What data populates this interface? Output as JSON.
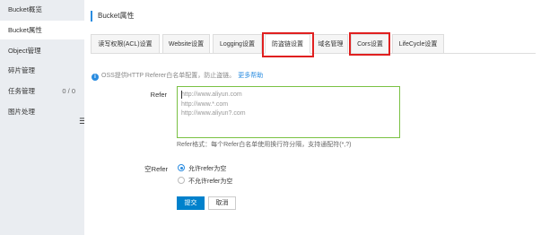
{
  "sidebar": {
    "items": [
      {
        "label": "Bucket概览",
        "count": ""
      },
      {
        "label": "Bucket属性",
        "count": ""
      },
      {
        "label": "Object管理",
        "count": ""
      },
      {
        "label": "碎片管理",
        "count": ""
      },
      {
        "label": "任务管理",
        "count": "0 / 0"
      },
      {
        "label": "图片处理",
        "count": ""
      }
    ],
    "active_index": 1,
    "collapse_glyph": "☰"
  },
  "header": {
    "title": "Bucket属性"
  },
  "tabs": [
    {
      "label": "读写权限(ACL)设置"
    },
    {
      "label": "Website设置"
    },
    {
      "label": "Logging设置"
    },
    {
      "label": "防盗链设置"
    },
    {
      "label": "域名管理"
    },
    {
      "label": "Cors设置"
    },
    {
      "label": "LifeCycle设置"
    }
  ],
  "active_tab_index": 3,
  "tip": {
    "icon": "info-icon",
    "text": "OSS提供HTTP Referer白名单配置，防止盗链。",
    "link": "更多帮助"
  },
  "form": {
    "refer_label": "Refer",
    "refer_placeholder": "http://www.aliyun.com\nhttp://www.*.com\nhttp://www.aliyun?.com",
    "refer_hint": "Refer格式：每个Refer白名单使用换行符分隔，支持通配符(*,?)",
    "empty_refer_label": "空Refer",
    "options": [
      {
        "label": "允许refer为空",
        "checked": true
      },
      {
        "label": "不允许refer为空",
        "checked": false
      }
    ],
    "submit_label": "提交",
    "cancel_label": "取消"
  },
  "colors": {
    "accent": "#0081cc",
    "highlight": "#e02020",
    "textarea_border": "#7ac143"
  }
}
